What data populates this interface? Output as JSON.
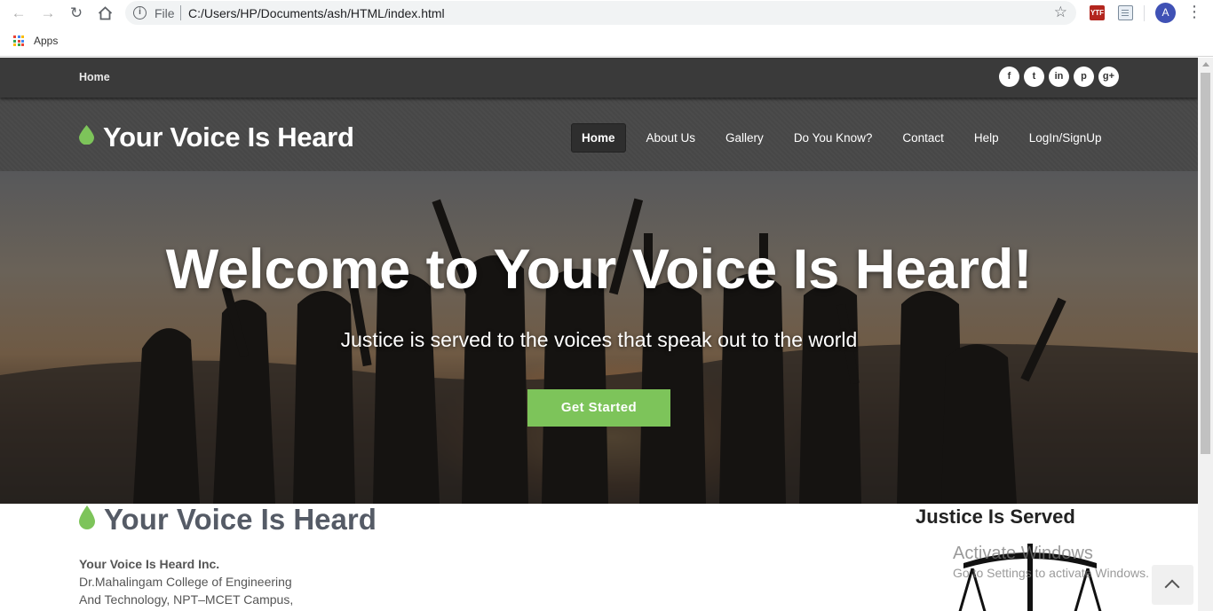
{
  "browser": {
    "omnibox": {
      "scheme_label": "File",
      "url": "C:/Users/HP/Documents/ash/HTML/index.html"
    },
    "extension_badge": "YTF",
    "profile_initial": "A",
    "bookmarks": {
      "apps_label": "Apps"
    }
  },
  "topbar": {
    "home_link": "Home",
    "social_icons": [
      "facebook-icon",
      "twitter-icon",
      "linkedin-icon",
      "pinterest-icon",
      "google-plus-icon"
    ],
    "social_glyphs": [
      "f",
      "t",
      "in",
      "p",
      "g+"
    ]
  },
  "navbar": {
    "brand": "Your Voice Is Heard",
    "menu": [
      {
        "label": "Home",
        "active": true
      },
      {
        "label": "About Us",
        "active": false
      },
      {
        "label": "Gallery",
        "active": false
      },
      {
        "label": "Do You Know?",
        "active": false
      },
      {
        "label": "Contact",
        "active": false
      },
      {
        "label": "Help",
        "active": false
      },
      {
        "label": "LogIn/SignUp",
        "active": false
      }
    ]
  },
  "hero": {
    "title": "Welcome to Your Voice Is Heard!",
    "subtitle": "Justice is served to the voices that speak out to the world",
    "cta": "Get Started"
  },
  "footer": {
    "brand": "Your Voice Is Heard",
    "org_name": "Your Voice Is Heard Inc.",
    "address_line1": "Dr.Mahalingam College of Engineering",
    "address_line2": "And Technology, NPT–MCET Campus,",
    "justice_title": "Justice Is Served"
  },
  "os_watermark": {
    "title": "Activate Windows",
    "subtitle": "Go to Settings to activate Windows."
  },
  "colors": {
    "accent_green": "#7dc45a",
    "topbar_bg": "#3a3a3a",
    "navbar_bg": "#4a4a4a",
    "active_menu_bg": "#2e2e2e"
  }
}
